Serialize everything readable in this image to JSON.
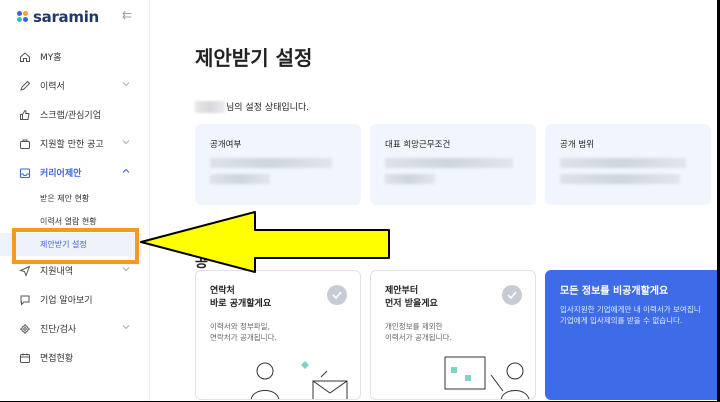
{
  "brand": {
    "name": "saramin",
    "colors": {
      "accent": "#3e63dd",
      "highlight": "#f39b1e",
      "arrow": "#ffff00"
    }
  },
  "sidebar": {
    "items": [
      {
        "label": "MY홈",
        "icon": "home-icon"
      },
      {
        "label": "이력서",
        "icon": "pencil-icon",
        "expandable": true
      },
      {
        "label": "스크랩/관심기업",
        "icon": "thumbs-up-icon"
      },
      {
        "label": "지원할 만한 공고",
        "icon": "briefcase-icon",
        "expandable": true
      },
      {
        "label": "커리어제안",
        "icon": "inbox-icon",
        "expandable": true,
        "active": true
      },
      {
        "label": "지원내역",
        "icon": "send-icon",
        "expandable": true
      },
      {
        "label": "기업 알아보기",
        "icon": "chat-icon"
      },
      {
        "label": "진단/검사",
        "icon": "gear-icon",
        "expandable": true
      },
      {
        "label": "면접현황",
        "icon": "calendar-icon"
      }
    ],
    "sub_items": [
      {
        "label": "받은 제안 현황"
      },
      {
        "label": "이력서 열람 현황"
      },
      {
        "label": "제안받기 설정",
        "selected": true
      }
    ]
  },
  "main": {
    "title": "제안받기 설정",
    "status_suffix": "님의 설정 상태입니다.",
    "cards": [
      {
        "title": "공개여부"
      },
      {
        "title": "대표 희망근무조건"
      },
      {
        "title": "공개 범위"
      }
    ],
    "section_fragment": "공",
    "options": [
      {
        "title": "연락처\n바로 공개할게요",
        "desc": "이력서와 정부파일,\n연락처가 공개됩니다."
      },
      {
        "title": "제안부터\n먼저 받을게요",
        "desc": "개인정보를 제외한\n이력서가 공개됩니다."
      },
      {
        "title": "모든 정보를 비공개할게요",
        "desc": "입사지원한 기업에게만 내 이력서가 보여집니\n기업에게 입사제의를 받을 수 없습니다."
      }
    ]
  }
}
